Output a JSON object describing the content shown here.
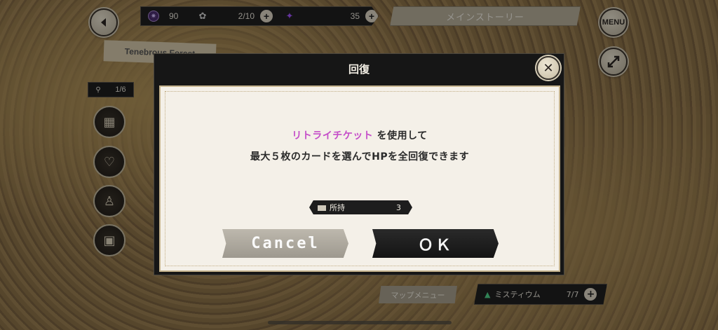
{
  "hud": {
    "back_icon": "back-arrow-icon",
    "menu_label": "MENU",
    "expand_icon": "expand-icon",
    "purple_gem_count": "90",
    "stamina": "2/10",
    "crystal_count": "35",
    "story_tab": "メインストーリー",
    "area_name": "Tenebrous Forest",
    "progress": "1/6",
    "side_icons": [
      "card-deck-icon",
      "heart-icon",
      "torch-icon",
      "treasure-chest-icon"
    ],
    "map_menu": "マップメニュー",
    "mystium_label": "ミスティウム",
    "mystium_count": "7/7"
  },
  "dialog": {
    "title": "回復",
    "close_icon": "close-icon",
    "item_name": "リトライチケット",
    "line1_suffix": " を使用して",
    "line2": "最大５枚のカードを選んでHPを全回復できます",
    "owned_label": "所持",
    "owned_count": "3",
    "cancel_label": "Cancel",
    "ok_label": "ＯＫ"
  },
  "colors": {
    "highlight": "#c54fc9",
    "dialog_bg": "#161616",
    "panel_bg": "#f4f0e8"
  }
}
